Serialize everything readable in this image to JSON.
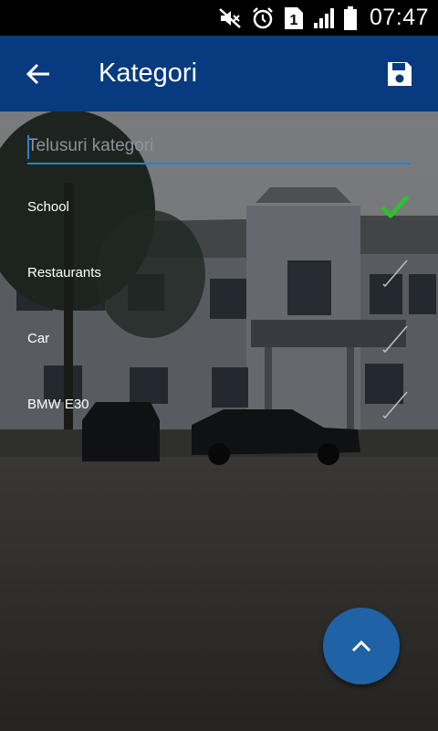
{
  "status_bar": {
    "time": "07:47",
    "sim_slot": "1",
    "icons": [
      "muted-icon",
      "alarm-icon",
      "sim-1-icon",
      "signal-icon",
      "battery-icon"
    ]
  },
  "app_bar": {
    "title": "Kategori",
    "back_icon": "arrow-left-icon",
    "save_icon": "floppy-disk-icon",
    "color": "#073a7e"
  },
  "search": {
    "placeholder": "Telusuri kategori",
    "value": "",
    "accent": "#2b7fd2"
  },
  "categories": [
    {
      "label": "School",
      "selected": true
    },
    {
      "label": "Restaurants",
      "selected": false
    },
    {
      "label": "Car",
      "selected": false
    },
    {
      "label": "BMW E30",
      "selected": false
    }
  ],
  "check_colors": {
    "selected": "#2fbf2f",
    "unselected": "#b8bec4"
  },
  "fab": {
    "icon": "chevron-up-icon",
    "color": "#1f63a6"
  }
}
